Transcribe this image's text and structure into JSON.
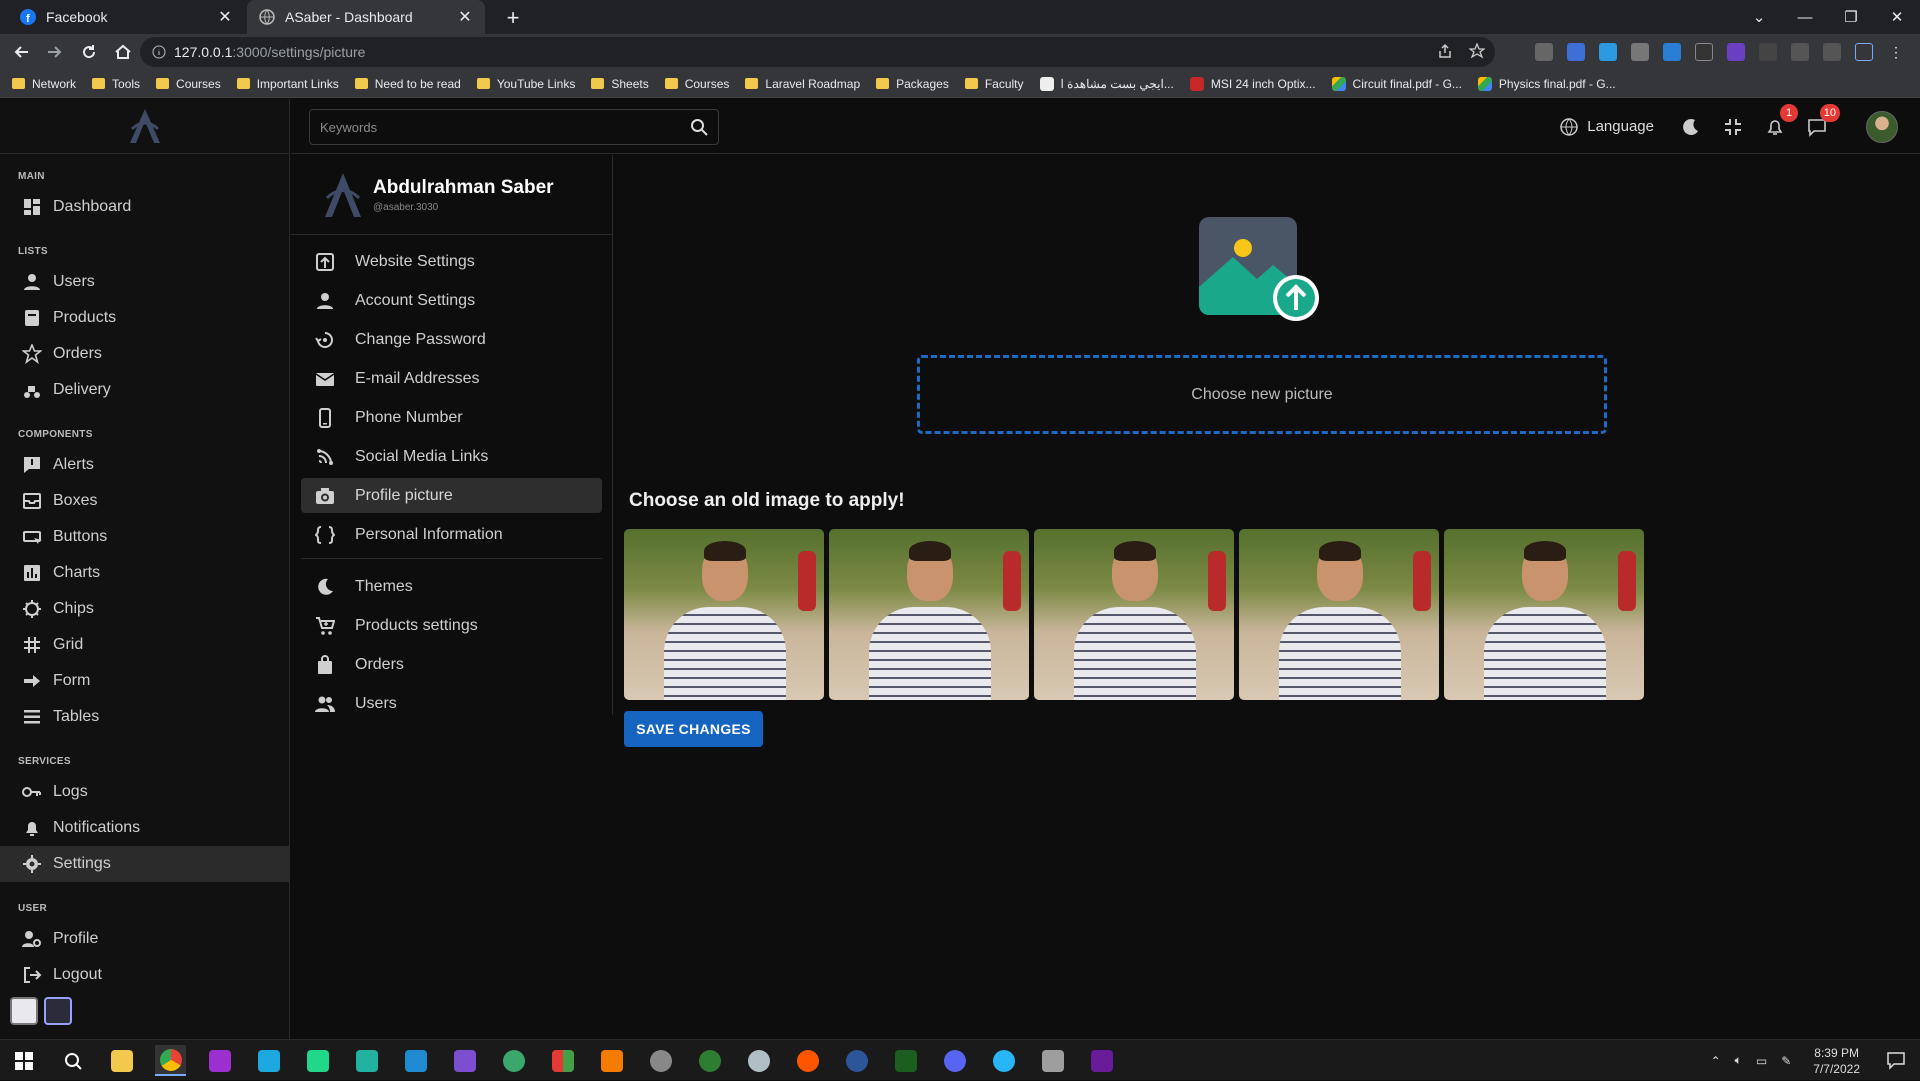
{
  "browser": {
    "tabs": [
      {
        "title": "Facebook",
        "icon": "facebook-icon"
      },
      {
        "title": "ASaber - Dashboard",
        "icon": "globe-icon"
      }
    ],
    "url_host": "127.0.0.1",
    "url_path": ":3000/settings/picture",
    "bookmarks": [
      {
        "label": "Network",
        "type": "folder"
      },
      {
        "label": "Tools",
        "type": "folder"
      },
      {
        "label": "Courses",
        "type": "folder"
      },
      {
        "label": "Important Links",
        "type": "folder"
      },
      {
        "label": "Need to be read",
        "type": "folder"
      },
      {
        "label": "YouTube Links",
        "type": "folder"
      },
      {
        "label": "Sheets",
        "type": "folder"
      },
      {
        "label": "Courses",
        "type": "folder"
      },
      {
        "label": "Laravel Roadmap",
        "type": "folder"
      },
      {
        "label": "Packages",
        "type": "folder"
      },
      {
        "label": "Faculty",
        "type": "folder"
      },
      {
        "label": "ايجي بست مشاهدة ا...",
        "type": "site"
      },
      {
        "label": "MSI 24 inch Optix...",
        "type": "site"
      },
      {
        "label": "Circuit final.pdf - G...",
        "type": "drive"
      },
      {
        "label": "Physics final.pdf - G...",
        "type": "drive"
      }
    ]
  },
  "sidebar": {
    "sections": [
      {
        "title": "MAIN",
        "items": [
          {
            "label": "Dashboard",
            "icon": "dashboard-icon"
          }
        ]
      },
      {
        "title": "LISTS",
        "items": [
          {
            "label": "Users",
            "icon": "user-icon"
          },
          {
            "label": "Products",
            "icon": "products-icon"
          },
          {
            "label": "Orders",
            "icon": "star-icon"
          },
          {
            "label": "Delivery",
            "icon": "delivery-icon"
          }
        ]
      },
      {
        "title": "COMPONENTS",
        "items": [
          {
            "label": "Alerts",
            "icon": "alert-icon"
          },
          {
            "label": "Boxes",
            "icon": "box-icon"
          },
          {
            "label": "Buttons",
            "icon": "button-icon"
          },
          {
            "label": "Charts",
            "icon": "chart-icon"
          },
          {
            "label": "Chips",
            "icon": "chip-icon"
          },
          {
            "label": "Grid",
            "icon": "grid-icon"
          },
          {
            "label": "Form",
            "icon": "form-icon"
          },
          {
            "label": "Tables",
            "icon": "table-icon"
          }
        ]
      },
      {
        "title": "SERVICES",
        "items": [
          {
            "label": "Logs",
            "icon": "key-icon"
          },
          {
            "label": "Notifications",
            "icon": "bell-icon"
          },
          {
            "label": "Settings",
            "icon": "gear-icon",
            "active": true
          }
        ]
      },
      {
        "title": "USER",
        "items": [
          {
            "label": "Profile",
            "icon": "profile-icon"
          },
          {
            "label": "Logout",
            "icon": "logout-icon"
          }
        ]
      }
    ]
  },
  "topbar": {
    "search_placeholder": "Keywords",
    "language_label": "Language",
    "notifications_count": "1",
    "messages_count": "10"
  },
  "profile": {
    "name": "Abdulrahman Saber",
    "handle": "@asaber.3030"
  },
  "settings_menu": {
    "group1": [
      {
        "label": "Website Settings",
        "icon": "website-icon"
      },
      {
        "label": "Account Settings",
        "icon": "account-icon"
      },
      {
        "label": "Change Password",
        "icon": "password-icon"
      },
      {
        "label": "E-mail Addresses",
        "icon": "mail-icon"
      },
      {
        "label": "Phone Number",
        "icon": "phone-icon"
      },
      {
        "label": "Social Media Links",
        "icon": "social-icon"
      },
      {
        "label": "Profile picture",
        "icon": "camera-icon",
        "active": true
      },
      {
        "label": "Personal Information",
        "icon": "info-icon"
      }
    ],
    "group2": [
      {
        "label": "Themes",
        "icon": "moon-icon"
      },
      {
        "label": "Products settings",
        "icon": "cart-icon"
      },
      {
        "label": "Orders",
        "icon": "bag-icon"
      },
      {
        "label": "Users",
        "icon": "users-icon"
      }
    ]
  },
  "main": {
    "dropzone_label": "Choose new picture",
    "old_images_title": "Choose an old image to apply!",
    "old_images_count": 5,
    "save_label": "SAVE CHANGES"
  },
  "taskbar": {
    "time": "8:39 PM",
    "date": "7/7/2022"
  }
}
